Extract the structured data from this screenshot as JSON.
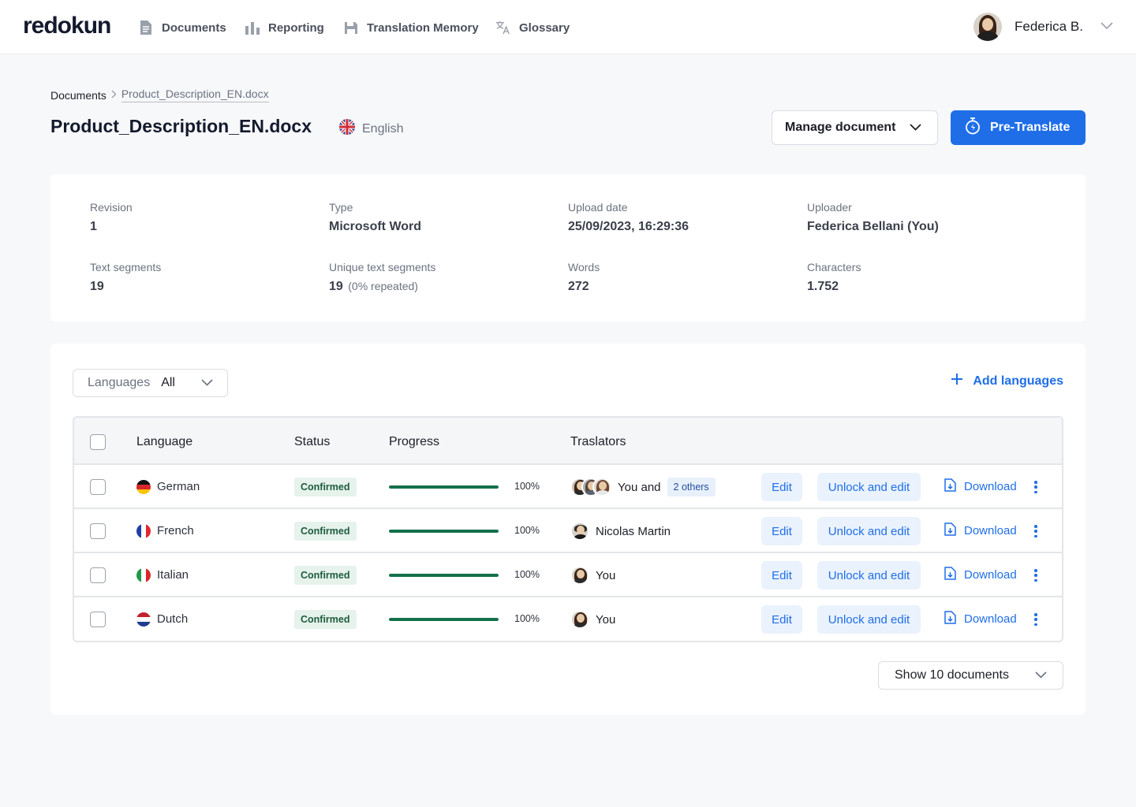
{
  "brand": {
    "logo": "redokun",
    "accent": "#1f6ee8"
  },
  "nav": [
    {
      "label": "Documents",
      "icon": "document-icon"
    },
    {
      "label": "Reporting",
      "icon": "bar-chart-icon"
    },
    {
      "label": "Translation Memory",
      "icon": "database-icon"
    },
    {
      "label": "Glossary",
      "icon": "translate-icon"
    }
  ],
  "user": {
    "name": "Federica B."
  },
  "breadcrumb": {
    "root": "Documents",
    "current": "Product_Description_EN.docx"
  },
  "document": {
    "title": "Product_Description_EN.docx",
    "source_language": "English"
  },
  "actions": {
    "manage": "Manage document",
    "pretranslate": "Pre-Translate"
  },
  "info": {
    "revision": {
      "label": "Revision",
      "value": "1"
    },
    "type": {
      "label": "Type",
      "value": "Microsoft Word"
    },
    "upload_date": {
      "label": "Upload date",
      "value": "25/09/2023, 16:29:36"
    },
    "uploader": {
      "label": "Uploader",
      "value": "Federica Bellani (You)"
    },
    "text_segments": {
      "label": "Text segments",
      "value": "19"
    },
    "unique_segments": {
      "label": "Unique text segments",
      "value": "19",
      "sub": "(0% repeated)"
    },
    "words": {
      "label": "Words",
      "value": "272"
    },
    "characters": {
      "label": "Characters",
      "value": "1.752"
    }
  },
  "languages_panel": {
    "filter_label": "Languages",
    "filter_value": "All",
    "add_label": "Add languages",
    "show_docs": "Show 10 documents",
    "headers": {
      "language": "Language",
      "status": "Status",
      "progress": "Progress",
      "translators": "Traslators"
    },
    "row_actions": {
      "edit": "Edit",
      "unlock": "Unlock and edit",
      "download": "Download"
    },
    "rows": [
      {
        "language": "German",
        "status": "Confirmed",
        "progress": 1.0,
        "progress_label": "100%",
        "translator": "You and",
        "others": "2 others"
      },
      {
        "language": "French",
        "status": "Confirmed",
        "progress": 1.0,
        "progress_label": "100%",
        "translator": "Nicolas Martin"
      },
      {
        "language": "Italian",
        "status": "Confirmed",
        "progress": 1.0,
        "progress_label": "100%",
        "translator": "You"
      },
      {
        "language": "Dutch",
        "status": "Confirmed",
        "progress": 1.0,
        "progress_label": "100%",
        "translator": "You"
      }
    ]
  }
}
